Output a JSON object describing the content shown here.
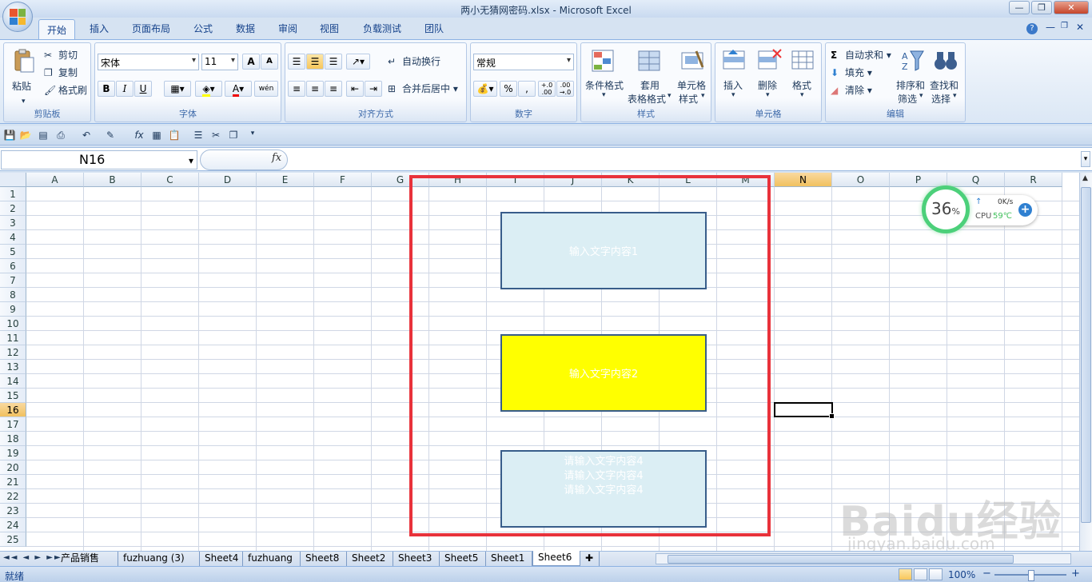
{
  "window": {
    "title": "两小无猜网密码.xlsx - Microsoft Excel",
    "min": "—",
    "max": "❐",
    "close": "✕"
  },
  "ribbon_tabs": [
    "开始",
    "插入",
    "页面布局",
    "公式",
    "数据",
    "审阅",
    "视图",
    "负载测试",
    "团队"
  ],
  "help_icons": [
    "?",
    "—",
    "❐",
    "✕"
  ],
  "clipboard": {
    "paste": "粘贴",
    "cut": "剪切",
    "copy": "复制",
    "format_painter": "格式刷",
    "label": "剪贴板"
  },
  "font": {
    "name": "宋体",
    "size": "11",
    "label": "字体",
    "bold": "B",
    "italic": "I",
    "underline": "U",
    "grow": "A",
    "shrink": "A",
    "font_color": "A",
    "phonetic": "wén"
  },
  "alignment": {
    "wrap": "自动换行",
    "merge": "合并后居中",
    "label": "对齐方式"
  },
  "number": {
    "format": "常规",
    "percent": "%",
    "comma": ",",
    "inc": "+.0 .00",
    "dec": ".00 →.0",
    "label": "数字"
  },
  "styles": {
    "conditional": "条件格式",
    "table_l1": "套用",
    "table_l2": "表格格式",
    "cell_l1": "单元格",
    "cell_l2": "样式",
    "label": "样式"
  },
  "cells": {
    "insert": "插入",
    "delete": "删除",
    "format": "格式",
    "label": "单元格"
  },
  "editing": {
    "autosum": "自动求和",
    "fill": "填充",
    "clear": "清除",
    "sort_l1": "排序和",
    "sort_l2": "筛选",
    "find_l1": "查找和",
    "find_l2": "选择",
    "label": "编辑",
    "sigma": "Σ"
  },
  "formula_bar": {
    "name_box": "N16",
    "fx": "fx",
    "expand": "▾"
  },
  "columns": [
    "A",
    "B",
    "C",
    "D",
    "E",
    "F",
    "G",
    "H",
    "I",
    "J",
    "K",
    "L",
    "M",
    "N",
    "O",
    "P",
    "Q",
    "R"
  ],
  "selected_column": "N",
  "rows": [
    "1",
    "2",
    "3",
    "4",
    "5",
    "6",
    "7",
    "8",
    "9",
    "10",
    "11",
    "12",
    "13",
    "14",
    "15",
    "16",
    "17",
    "18",
    "19",
    "20",
    "21",
    "22",
    "23",
    "24",
    "25"
  ],
  "selected_row": "16",
  "shapes": [
    {
      "text": "输入文字内容1",
      "fill": "#dbeef4"
    },
    {
      "text": "输入文字内容2",
      "fill": "#ffff00"
    },
    {
      "lines": [
        "请输入文字内容4",
        "请输入文字内容4",
        "请输入文字内容4"
      ],
      "fill": "#dbeef4"
    }
  ],
  "frame_color": "#e8323b",
  "cpu_widget": {
    "percent": "36",
    "percent_unit": "%",
    "net": "0K/s",
    "cpu_label": "CPU",
    "temp": "59℃",
    "arrow": "↑",
    "plus": "+"
  },
  "sheet_tabs": [
    "产品销售",
    "fuzhuang (3)",
    "Sheet4",
    "fuzhuang",
    "Sheet8",
    "Sheet2",
    "Sheet3",
    "Sheet5",
    "Sheet1",
    "Sheet6"
  ],
  "active_sheet": "Sheet6",
  "sheet_nav": "◄◄ ◄ ► ►►",
  "status": {
    "ready": "就绪",
    "zoom": "100%",
    "minus": "−",
    "plus": "+"
  },
  "watermark": {
    "brand": "Baidu经验",
    "url": "jingyan.baidu.com"
  }
}
